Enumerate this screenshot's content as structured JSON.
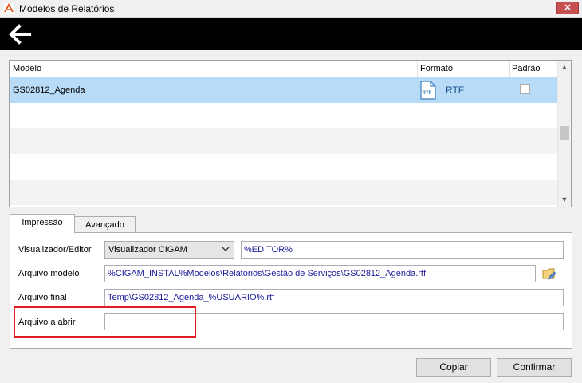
{
  "window": {
    "title": "Modelos de Relatórios",
    "close_label": "✕"
  },
  "grid": {
    "columns": {
      "modelo": "Modelo",
      "formato": "Formato",
      "padrao": "Padrão"
    },
    "rows": [
      {
        "name": "GS02812_Agenda",
        "format_icon_text": "RTF",
        "format": "RTF",
        "padrao_checked": false
      }
    ],
    "scroll_up": "▲",
    "scroll_down": "▼"
  },
  "tabs": {
    "impressao": "Impressão",
    "avancado": "Avançado"
  },
  "form": {
    "visualizador_label": "Visualizador/Editor",
    "visualizador_value": "Visualizador CIGAM",
    "editor_value": "%EDITOR%",
    "arquivo_modelo_label": "Arquivo modelo",
    "arquivo_modelo_value": "%CIGAM_INSTAL%Modelos\\Relatorios\\Gestão de Serviços\\GS02812_Agenda.rtf",
    "arquivo_final_label": "Arquivo final",
    "arquivo_final_value": "Temp\\GS02812_Agenda_%USUARIO%.rtf",
    "arquivo_abrir_label": "Arquivo a abrir",
    "arquivo_abrir_value": ""
  },
  "buttons": {
    "copiar": "Copiar",
    "confirmar": "Confirmar"
  },
  "colors": {
    "selection": "#b8dcf8",
    "highlight_border": "#e31b23",
    "title_close": "#c75050",
    "link_text": "#1a1a9a"
  },
  "icons": [
    "app-icon",
    "back-arrow-icon",
    "rtf-file-icon",
    "chevron-down-icon",
    "folder-edit-icon",
    "close-icon"
  ]
}
